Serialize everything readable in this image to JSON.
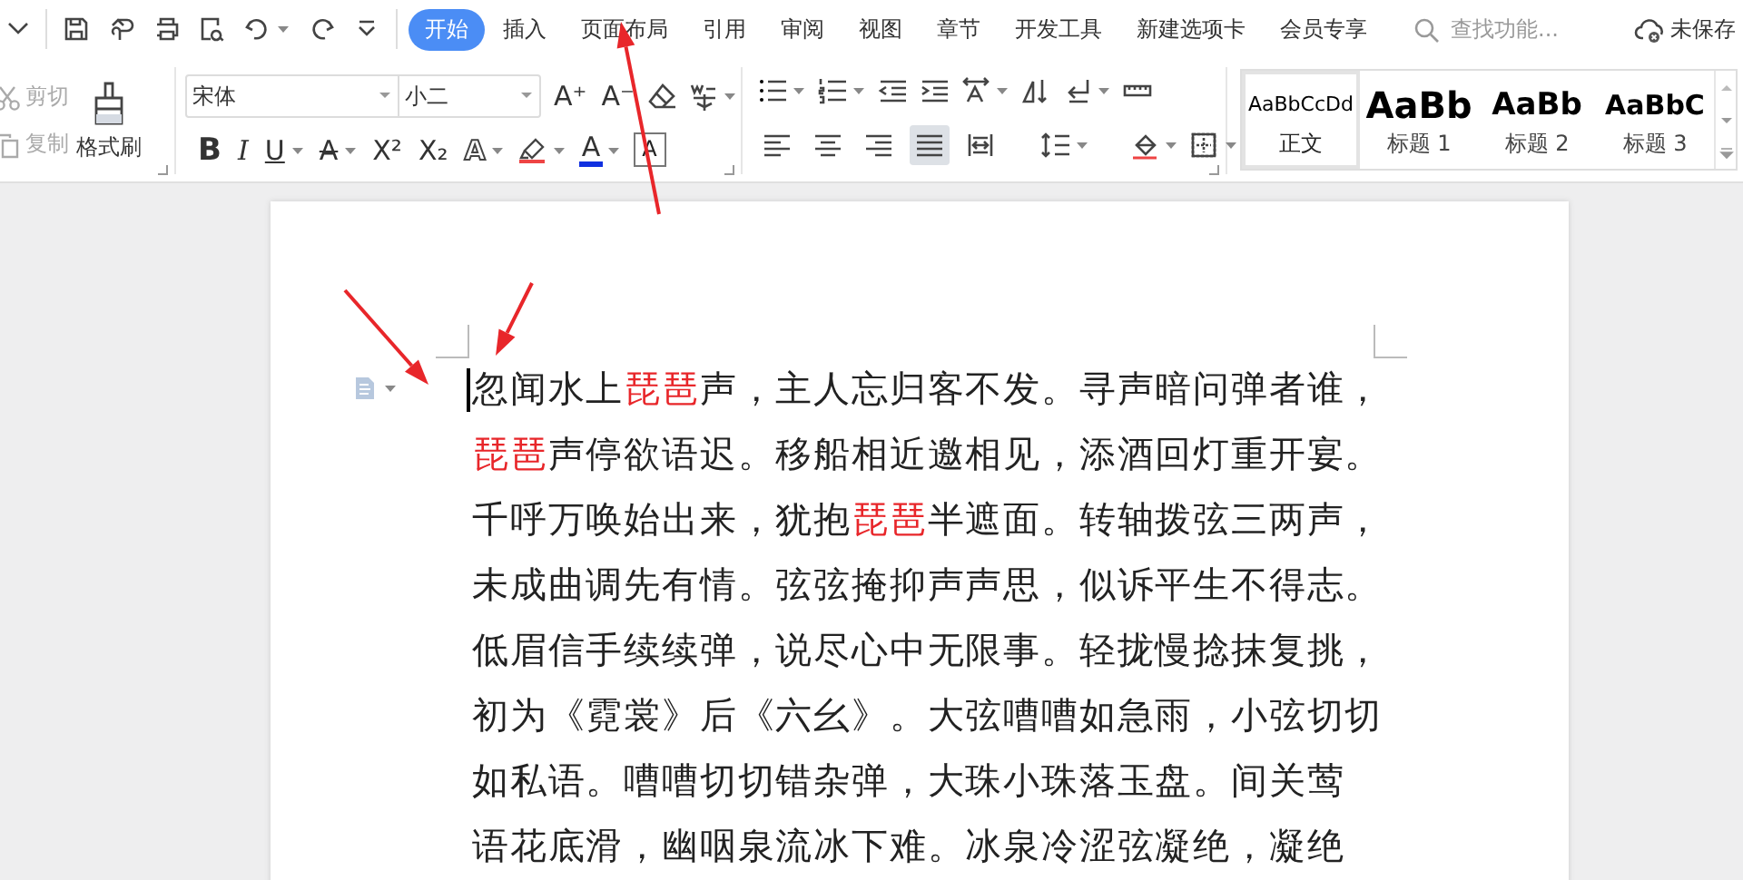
{
  "menu_tabs": [
    {
      "label": "开始",
      "selected": true
    },
    {
      "label": "插入",
      "selected": false
    },
    {
      "label": "页面布局",
      "selected": false
    },
    {
      "label": "引用",
      "selected": false
    },
    {
      "label": "审阅",
      "selected": false
    },
    {
      "label": "视图",
      "selected": false
    },
    {
      "label": "章节",
      "selected": false
    },
    {
      "label": "开发工具",
      "selected": false
    },
    {
      "label": "新建选项卡",
      "selected": false
    },
    {
      "label": "会员专享",
      "selected": false
    }
  ],
  "search": {
    "placeholder": "查找功能..."
  },
  "save_status": "未保存",
  "clipboard": [
    {
      "label": "剪切",
      "disabled": true
    },
    {
      "label": "复制",
      "disabled": true
    }
  ],
  "format_painter": {
    "label": "格式刷"
  },
  "font": {
    "name": "宋体",
    "size": "小二"
  },
  "font_row1": [
    {
      "glyph": "A⁺",
      "dropdown": false
    },
    {
      "glyph": "A⁻",
      "dropdown": false
    }
  ],
  "font_row2": [
    {
      "glyph": "B",
      "dropdown": false
    },
    {
      "glyph": "I",
      "dropdown": false
    },
    {
      "glyph": "U",
      "dropdown": true
    },
    {
      "glyph": "A",
      "dropdown": true
    },
    {
      "glyph": "X²",
      "dropdown": false
    },
    {
      "glyph": "X₂",
      "dropdown": false
    },
    {
      "glyph": "A",
      "dropdown": true
    },
    {
      "glyph": "A",
      "dropdown": true
    },
    {
      "glyph": "A",
      "dropdown": false
    }
  ],
  "align_buttons": [
    {
      "selected": false
    },
    {
      "selected": false
    },
    {
      "selected": false
    },
    {
      "selected": true
    },
    {
      "selected": false
    }
  ],
  "styles": [
    {
      "preview": "AaBbCcDd",
      "label": "正文",
      "kind": "body",
      "selected": true
    },
    {
      "preview": "AaBb",
      "label": "标题 1",
      "kind": "heading1",
      "selected": false
    },
    {
      "preview": "AaBb",
      "label": "标题 2",
      "kind": "heading2",
      "selected": false
    },
    {
      "preview": "AaBbC",
      "label": "标题 3",
      "kind": "heading3",
      "selected": false
    }
  ],
  "document": {
    "cursor": true,
    "lines": [
      [
        {
          "text": "忽闻水上",
          "highlighted": false
        },
        {
          "text": "琵琶",
          "highlighted": true
        },
        {
          "text": "声，主人忘归客不发。寻声暗问弹者谁，",
          "highlighted": false
        }
      ],
      [
        {
          "text": "琵琶",
          "highlighted": true
        },
        {
          "text": "声停欲语迟。移船相近邀相见，添酒回灯重开宴。",
          "highlighted": false
        }
      ],
      [
        {
          "text": "千呼万唤始出来，犹抱",
          "highlighted": false
        },
        {
          "text": "琵琶",
          "highlighted": true
        },
        {
          "text": "半遮面。转轴拨弦三两声，",
          "highlighted": false
        }
      ],
      [
        {
          "text": "未成曲调先有情。弦弦掩抑声声思，似诉平生不得志。",
          "highlighted": false
        }
      ],
      [
        {
          "text": "低眉信手续续弹，说尽心中无限事。轻拢慢捻抹复挑，",
          "highlighted": false
        }
      ],
      [
        {
          "text": "初为《霓裳》后《六幺》。大弦嘈嘈如急雨，小弦切切",
          "highlighted": false
        }
      ],
      [
        {
          "text": "如私语。嘈嘈切切错杂弹，大珠小珠落玉盘。间关莺",
          "highlighted": false
        }
      ],
      [
        {
          "text": "语花底滑，幽咽泉流冰下难。冰泉冷涩弦凝绝，凝绝",
          "highlighted": false
        }
      ]
    ]
  }
}
